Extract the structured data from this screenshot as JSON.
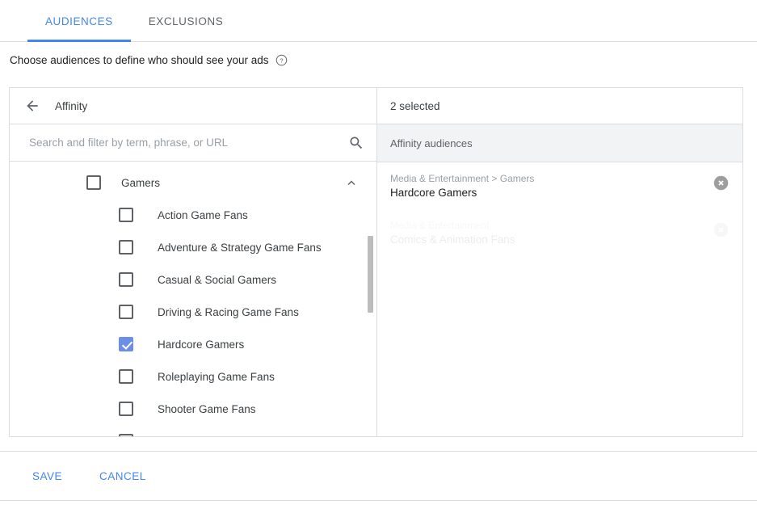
{
  "tabs": [
    {
      "label": "AUDIENCES",
      "active": true
    },
    {
      "label": "EXCLUSIONS",
      "active": false
    }
  ],
  "description": {
    "text": "Choose audiences to define who should see your ads",
    "help_icon": "help-circle-icon"
  },
  "panel": {
    "back_icon": "arrow-left-icon",
    "title": "Affinity",
    "search": {
      "placeholder": "Search and filter by term, phrase, or URL",
      "value": "",
      "icon": "search-icon"
    },
    "group": {
      "label": "Gamers",
      "checked": false,
      "expand_icon": "chevron-up-icon",
      "expanded": true
    },
    "items": [
      {
        "label": "Action Game Fans",
        "checked": false
      },
      {
        "label": "Adventure & Strategy Game Fans",
        "checked": false
      },
      {
        "label": "Casual & Social Gamers",
        "checked": false
      },
      {
        "label": "Driving & Racing Game Fans",
        "checked": false
      },
      {
        "label": "Hardcore Gamers",
        "checked": true,
        "focused": true
      },
      {
        "label": "Roleplaying Game Fans",
        "checked": false
      },
      {
        "label": "Shooter Game Fans",
        "checked": false
      },
      {
        "label": "",
        "checked": false
      }
    ]
  },
  "selected_panel": {
    "count_label": "2 selected",
    "group_label": "Affinity audiences",
    "items": [
      {
        "path": "Media & Entertainment > Gamers",
        "name": "Hardcore Gamers",
        "remove_icon": "close-circle-icon",
        "fading": false
      },
      {
        "path": "Media & Entertainment",
        "name": "Comics & Animation Fans",
        "remove_icon": "close-circle-icon",
        "fading": true
      }
    ]
  },
  "footer": {
    "save_label": "SAVE",
    "cancel_label": "CANCEL"
  },
  "colors": {
    "accent_blue": "#4285f4",
    "checkbox_blue": "#6b8fe8",
    "border": "#dadce0",
    "muted_text": "#9aa0a6",
    "group_bg": "#f1f3f4"
  }
}
